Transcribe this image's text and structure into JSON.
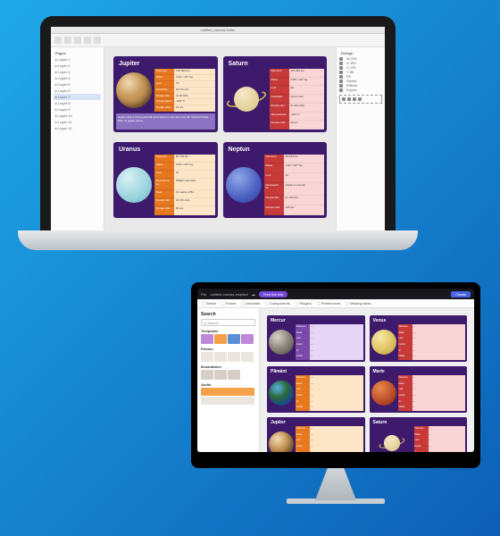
{
  "laptop": {
    "title_bar": "untitled_canvas.folder",
    "left_panel": {
      "heading": "Pages",
      "layers": [
        "Layer 1",
        "Layer 2",
        "Layer 3",
        "Layer 4",
        "Layer 5",
        "Layer 6",
        "Layer 7",
        "Layer 8",
        "Layer 9",
        "Layer 10",
        "Layer 11",
        "Layer 12"
      ],
      "selected_index": 6
    },
    "right_panel": {
      "heading": "Design",
      "rows": [
        "W 200",
        "H 150",
        "X 120",
        "Y 80",
        "Fill",
        "Stroke",
        "Effects",
        "Export"
      ]
    },
    "cards": [
      {
        "name": "Jupiter",
        "variant": "orange",
        "planet": "jup",
        "labels": [
          "Diametru",
          "Masa",
          "Luni",
          "Gravitatie",
          "Durata zilei",
          "Temperatura",
          "Durata orbit."
        ],
        "values": [
          "139 822 km",
          "1.90 × 10²⁷ kg",
          "79",
          "24.79 m/s²",
          "0z 9h 56m",
          "-108 °C",
          "12 ani"
        ],
        "desc": "Jupiter este a cincea planetă de la Soare și cea mai mare din Sistemul Solar. Este un gigant gazos."
      },
      {
        "name": "Saturn",
        "variant": "red",
        "planet": "sat",
        "labels": [
          "Diametru",
          "Masa",
          "Luni",
          "Gravitatie",
          "Durata zilei",
          "Temperatura",
          "Durata orbit."
        ],
        "values": [
          "116 464 km",
          "5.68 × 10²⁶ kg",
          "82",
          "10.44 m/s²",
          "0z 10h 42m",
          "-139 °C",
          "29 ani"
        ]
      },
      {
        "name": "Uranus",
        "variant": "orange",
        "planet": "ura",
        "labels": [
          "Diametru",
          "Masa",
          "Luni",
          "Descoperit de",
          "Data",
          "Durata zilei",
          "Durata orbit."
        ],
        "values": [
          "50 724 km",
          "8.68 × 10²⁵ kg",
          "27",
          "William Herschel",
          "13 martie 1781",
          "0z 17h 14m",
          "84 ani"
        ]
      },
      {
        "name": "Neptun",
        "variant": "red",
        "planet": "nep",
        "labels": [
          "Diametru",
          "Masa",
          "Luni",
          "Descoperit de",
          "Durata zilei",
          "Durata orbit."
        ],
        "values": [
          "49 244 km",
          "1.02 × 10²⁶ kg",
          "14",
          "Urbain Le Verrier",
          "0z 16h 6m",
          "165 ani"
        ]
      }
    ]
  },
  "imac": {
    "filename": "untitled-canvas-inspired",
    "badge": "Free live link",
    "share": "Create",
    "toolbar": [
      "Select",
      "Frame",
      "Annotate",
      "Components",
      "Plugins",
      "Preferences",
      "Missing fonts"
    ],
    "left_panel": {
      "heading": "Search",
      "placeholder": "Q Search",
      "sections": [
        "Templates",
        "Photos",
        "Illustrations",
        "Audio"
      ]
    },
    "cards": [
      {
        "name": "Mercur",
        "variant": "p",
        "planet": "mer"
      },
      {
        "name": "Venus",
        "variant": "r",
        "planet": "ven"
      },
      {
        "name": "Pământ",
        "variant": "",
        "planet": "ear"
      },
      {
        "name": "Marte",
        "variant": "r",
        "planet": "mar"
      },
      {
        "name": "Jupiter",
        "variant": "",
        "planet": "jup"
      },
      {
        "name": "Saturn",
        "variant": "r",
        "planet": "sat"
      }
    ],
    "info_labels": [
      "Diametru",
      "Masa",
      "Luni",
      "Gravit.",
      "Zi",
      "Orbita"
    ],
    "info_values": [
      "—",
      "—",
      "—",
      "—",
      "—",
      "—"
    ]
  }
}
